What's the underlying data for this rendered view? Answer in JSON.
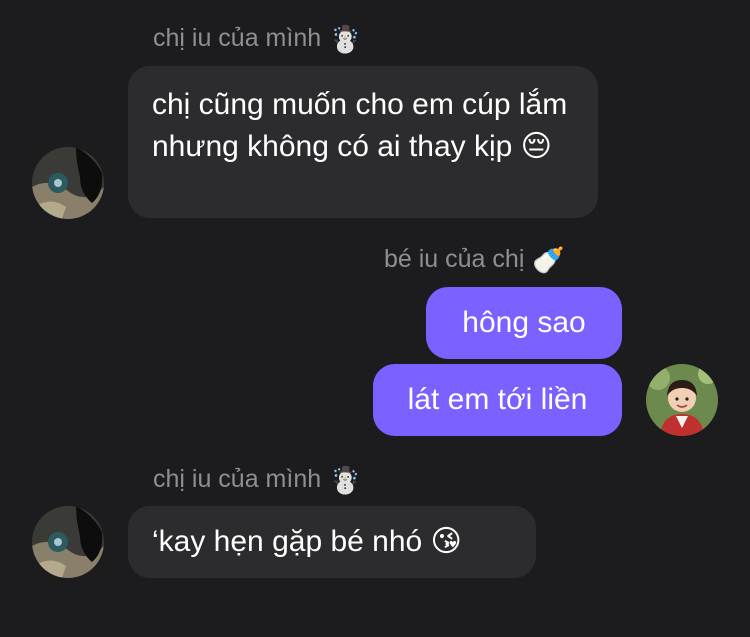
{
  "messages": [
    {
      "sender": "chị iu của mình",
      "sender_emoji": "☃️",
      "text": "chị cũng muốn cho em cúp lắm nhưng không có ai thay kịp 😔"
    },
    {
      "sender": "bé iu của chị",
      "sender_emoji": "🍼",
      "texts": [
        "hông sao",
        "lát em tới liền"
      ]
    },
    {
      "sender": "chị iu của mình",
      "sender_emoji": "☃️",
      "text": "‘kay hẹn gặp bé nhó 😘"
    }
  ],
  "colors": {
    "background": "#1c1c1e",
    "incoming_bubble": "#2c2c2e",
    "outgoing_bubble": "#7b61ff",
    "sender_name": "#8e8e93"
  },
  "avatars": {
    "contact": "contact-avatar-photo",
    "self": "self-avatar-photo"
  }
}
